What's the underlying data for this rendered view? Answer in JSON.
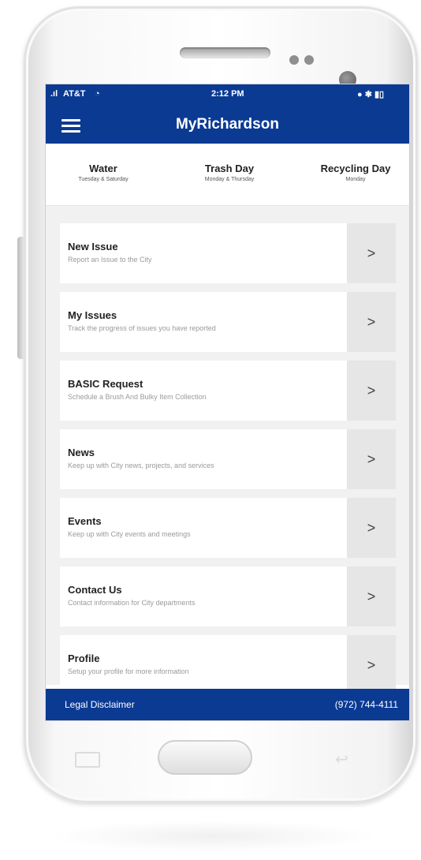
{
  "status_bar": {
    "carrier": "AT&T",
    "time": "2:12 PM",
    "icons_right": "● ✱ ▮▯"
  },
  "app_bar": {
    "title": "MyRichardson"
  },
  "schedule": [
    {
      "title": "Water",
      "sub": "Tuesday & Saturday"
    },
    {
      "title": "Trash Day",
      "sub": "Monday & Thursday"
    },
    {
      "title": "Recycling Day",
      "sub": "Monday"
    }
  ],
  "menu_items": [
    {
      "title": "New Issue",
      "sub": "Report an Issue to the City"
    },
    {
      "title": "My Issues",
      "sub": "Track the progress of issues you have reported"
    },
    {
      "title": "BASIC Request",
      "sub": "Schedule a Brush And Bulky Item Collection"
    },
    {
      "title": "News",
      "sub": "Keep up with City news, projects, and services"
    },
    {
      "title": "Events",
      "sub": "Keep up with City events and meetings"
    },
    {
      "title": "Contact Us",
      "sub": "Contact information for City departments"
    },
    {
      "title": "Profile",
      "sub": "Setup your profile for more information"
    }
  ],
  "chevron": ">",
  "footer": {
    "left": "Legal Disclaimer",
    "right": "(972) 744-4111"
  },
  "colors": {
    "brand_blue": "#0b3a93",
    "row_button": "#e6e6e6"
  },
  "icons": [
    "menu-icon",
    "wifi-icon",
    "battery-icon",
    "chevron-right-icon",
    "back-icon"
  ]
}
